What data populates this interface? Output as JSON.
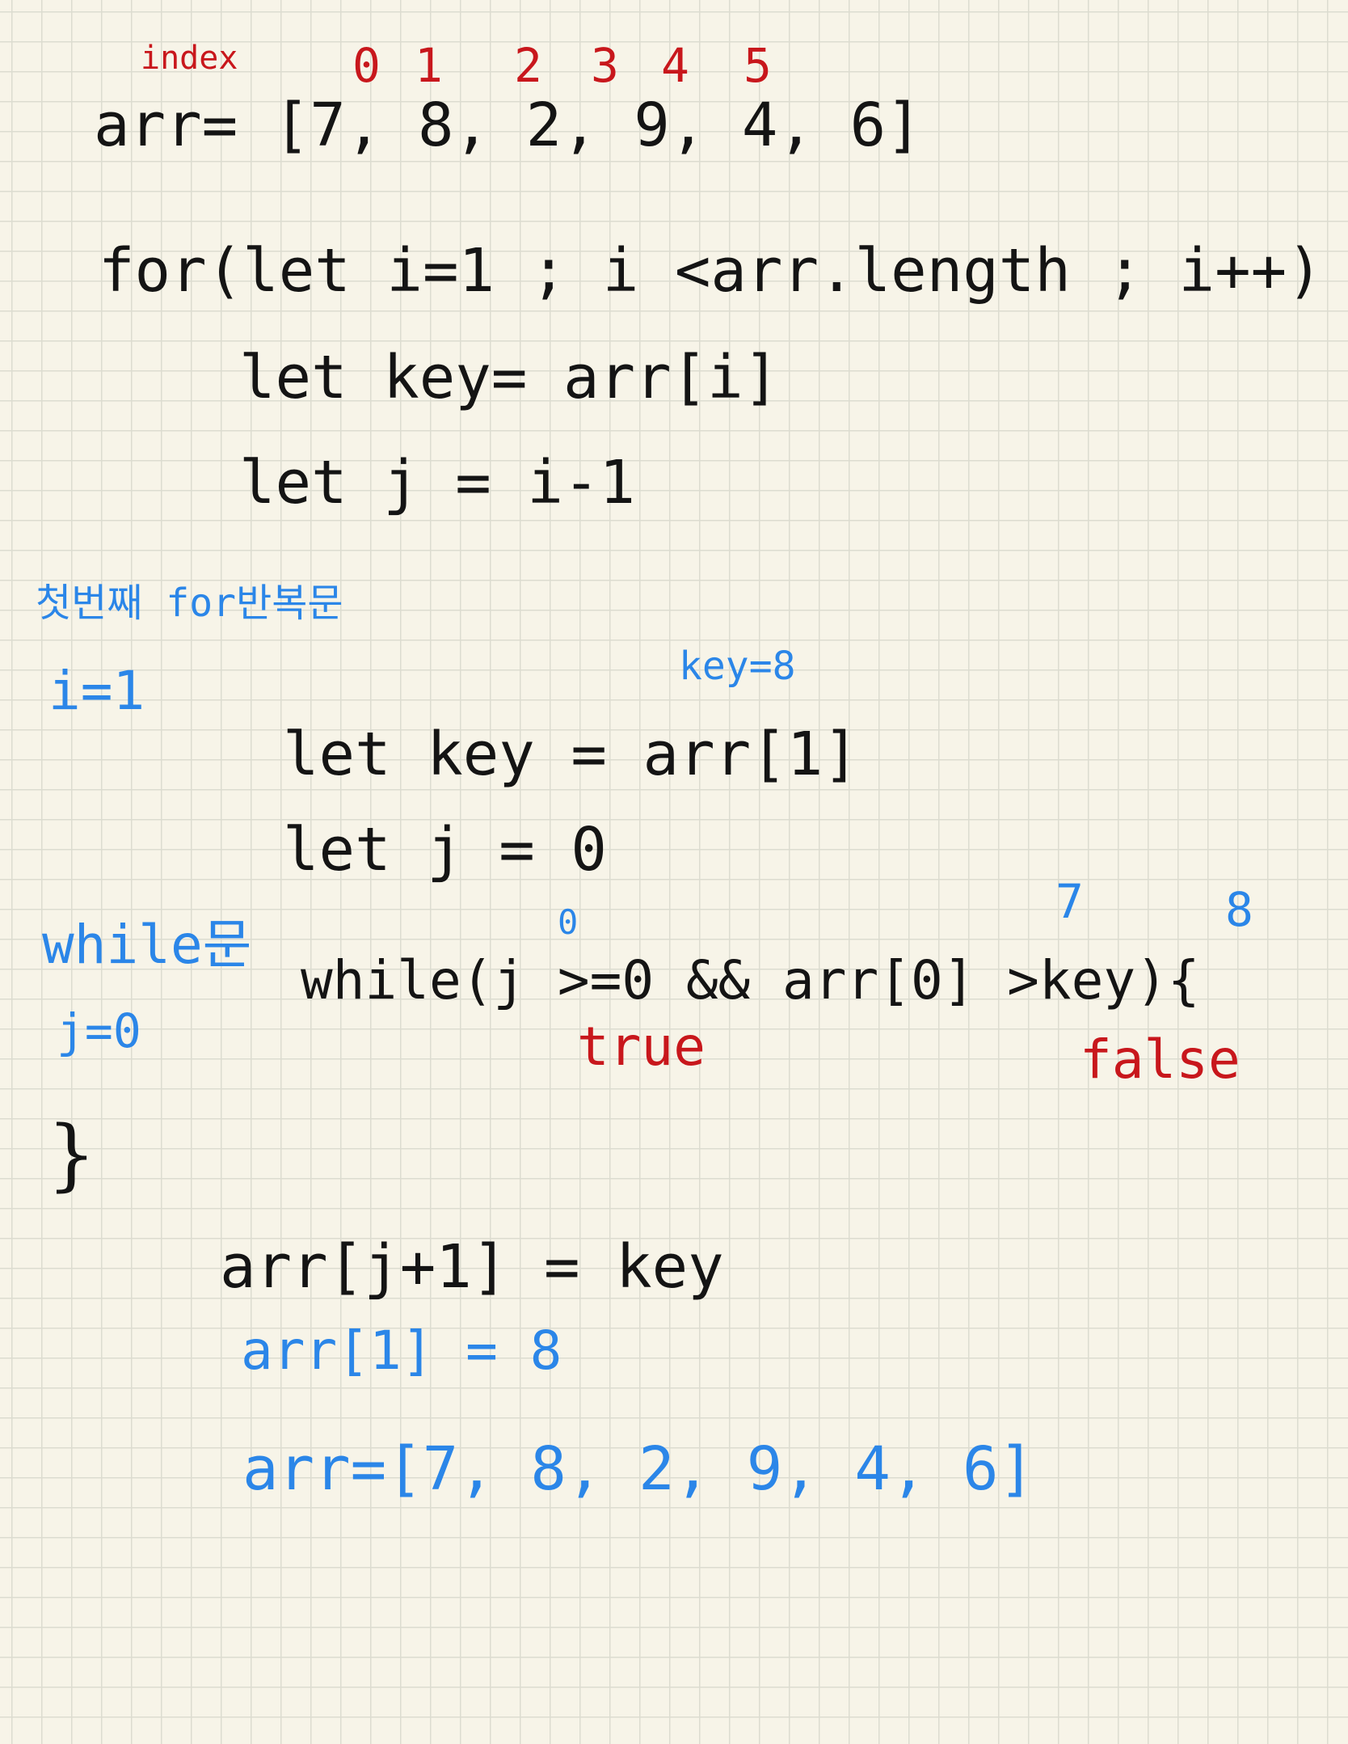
{
  "page": {
    "background": "#f7f4e8",
    "grid_color": "#dcdcd0",
    "ink_colors": {
      "black": "#141414",
      "blue": "#2b86e8",
      "red": "#c8171c"
    }
  },
  "array_header": {
    "index_label": "index",
    "indices": [
      "0",
      "1",
      "2",
      "3",
      "4",
      "5"
    ],
    "array_line": "arr= [7, 8, 2, 9, 4, 6]"
  },
  "code": {
    "for_line": "for(let i=1 ; i <arr.length ; i++)",
    "key_line": "let key= arr[i]",
    "j_line": "let j = i-1"
  },
  "first_iteration": {
    "heading": "첫번째 for반복문",
    "i_value": "i=1",
    "key_note": "key=8",
    "key_line": "let key = arr[1]",
    "j_line": "let j = 0"
  },
  "while_section": {
    "heading": "while문",
    "j_value": "j=0",
    "note_j": "0",
    "note_arr": "7",
    "note_key": "8",
    "while_line": "while(j >=0 && arr[0] >key){",
    "true_label": "true",
    "false_label": "false",
    "close_brace": "}"
  },
  "assignment": {
    "line": "arr[j+1] = key",
    "result": "arr[1] = 8",
    "final_array": "arr=[7, 8, 2, 9, 4, 6]"
  }
}
